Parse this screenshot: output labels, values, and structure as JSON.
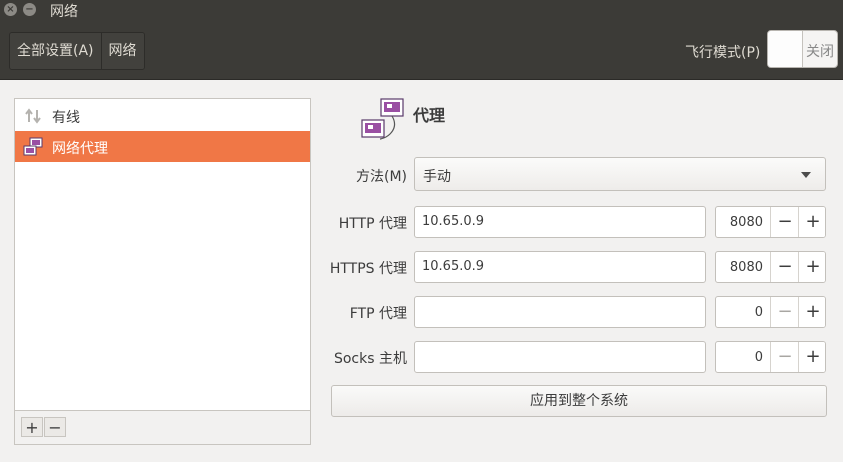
{
  "window": {
    "title": "网络"
  },
  "header": {
    "breadcrumbs": [
      "全部设置(A)",
      "网络"
    ],
    "airplane_label": "飞行模式(P)",
    "airplane_state": "关闭"
  },
  "list": {
    "items": [
      {
        "label": "有线",
        "icon": "wired-arrows-icon",
        "selected": false
      },
      {
        "label": "网络代理",
        "icon": "network-proxy-icon",
        "selected": true
      }
    ],
    "add": "+",
    "remove": "−"
  },
  "proxy": {
    "title": "代理",
    "method_label": "方法(M)",
    "method_value": "手动",
    "rows": [
      {
        "label": "HTTP 代理",
        "host": "10.65.0.9",
        "port": "8080"
      },
      {
        "label": "HTTPS 代理",
        "host": "10.65.0.9",
        "port": "8080"
      },
      {
        "label": "FTP 代理",
        "host": "",
        "port": "0"
      },
      {
        "label": "Socks 主机",
        "host": "",
        "port": "0"
      }
    ],
    "apply_label": "应用到整个系统"
  },
  "colors": {
    "selection": "#f07746",
    "headerbar": "#3c3b37"
  }
}
